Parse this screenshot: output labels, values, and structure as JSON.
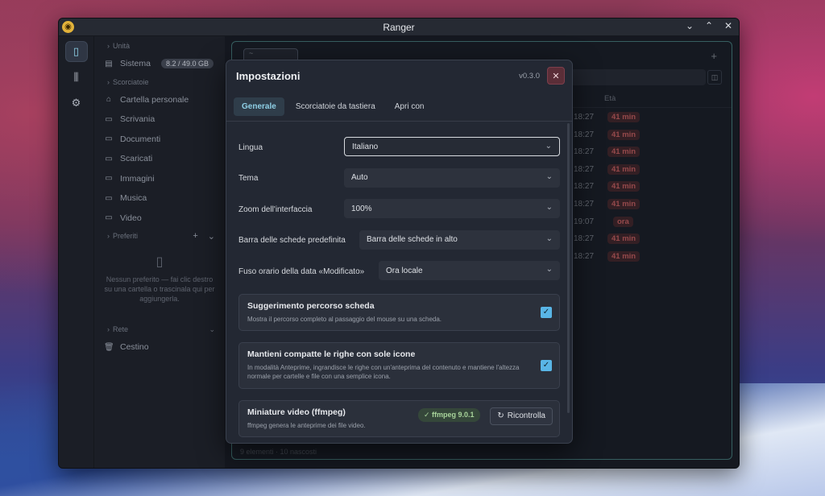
{
  "window": {
    "title": "Ranger"
  },
  "sidebar": {
    "sections": {
      "drives": "Unità",
      "shortcuts": "Scorciatoie",
      "favorites": "Preferiti",
      "network": "Rete"
    },
    "drive": {
      "label": "Sistema",
      "usage": "8.2 / 49.0 GB"
    },
    "shortcuts": [
      "Cartella personale",
      "Scrivania",
      "Documenti",
      "Scaricati",
      "Immagini",
      "Musica",
      "Video"
    ],
    "favorites_empty": "Nessun preferito — fai clic destro su una cartella o trascinala qui per aggiungerla.",
    "trash": "Cestino"
  },
  "main": {
    "tab_label": "~",
    "column_age": "Età",
    "rows": [
      {
        "time": "18:27",
        "age": "41 min"
      },
      {
        "time": "18:27",
        "age": "41 min"
      },
      {
        "time": "18:27",
        "age": "41 min"
      },
      {
        "time": "18:27",
        "age": "41 min"
      },
      {
        "time": "18:27",
        "age": "41 min"
      },
      {
        "time": "18:27",
        "age": "41 min"
      },
      {
        "time": "19:07",
        "age": "ora"
      },
      {
        "time": "18:27",
        "age": "41 min"
      },
      {
        "time": "18:27",
        "age": "41 min"
      }
    ],
    "footer": "9 elementi · 10 nascosti"
  },
  "dialog": {
    "title": "Impostazioni",
    "version": "v0.3.0",
    "tabs": [
      "Generale",
      "Scorciatoie da tastiera",
      "Apri con"
    ],
    "settings": {
      "language": {
        "label": "Lingua",
        "value": "Italiano"
      },
      "theme": {
        "label": "Tema",
        "value": "Auto"
      },
      "zoom": {
        "label": "Zoom dell'interfaccia",
        "value": "100%"
      },
      "tabbar": {
        "label": "Barra delle schede predefinita",
        "value": "Barra delle schede in alto"
      },
      "timezone": {
        "label": "Fuso orario della data «Modificato»",
        "value": "Ora locale"
      }
    },
    "cards": {
      "tab_path": {
        "title": "Suggerimento percorso scheda",
        "desc": "Mostra il percorso completo al passaggio del mouse su una scheda.",
        "checked": true
      },
      "compact_rows": {
        "title": "Mantieni compatte le righe con sole icone",
        "desc": "In modalità Anteprime, ingrandisce le righe con un'anteprima del contenuto e mantiene l'altezza normale per cartelle e file con una semplice icona.",
        "checked": true
      },
      "video_thumbs": {
        "title": "Miniature video (ffmpeg)",
        "desc": "ffmpeg genera le anteprime dei file video.",
        "badge": "ffmpeg 9.0.1",
        "button": "Ricontrolla"
      }
    }
  },
  "colors": {
    "accent": "#59b5e6",
    "age_badge": "#e06a6a",
    "border_teal": "#4f8d8a"
  }
}
